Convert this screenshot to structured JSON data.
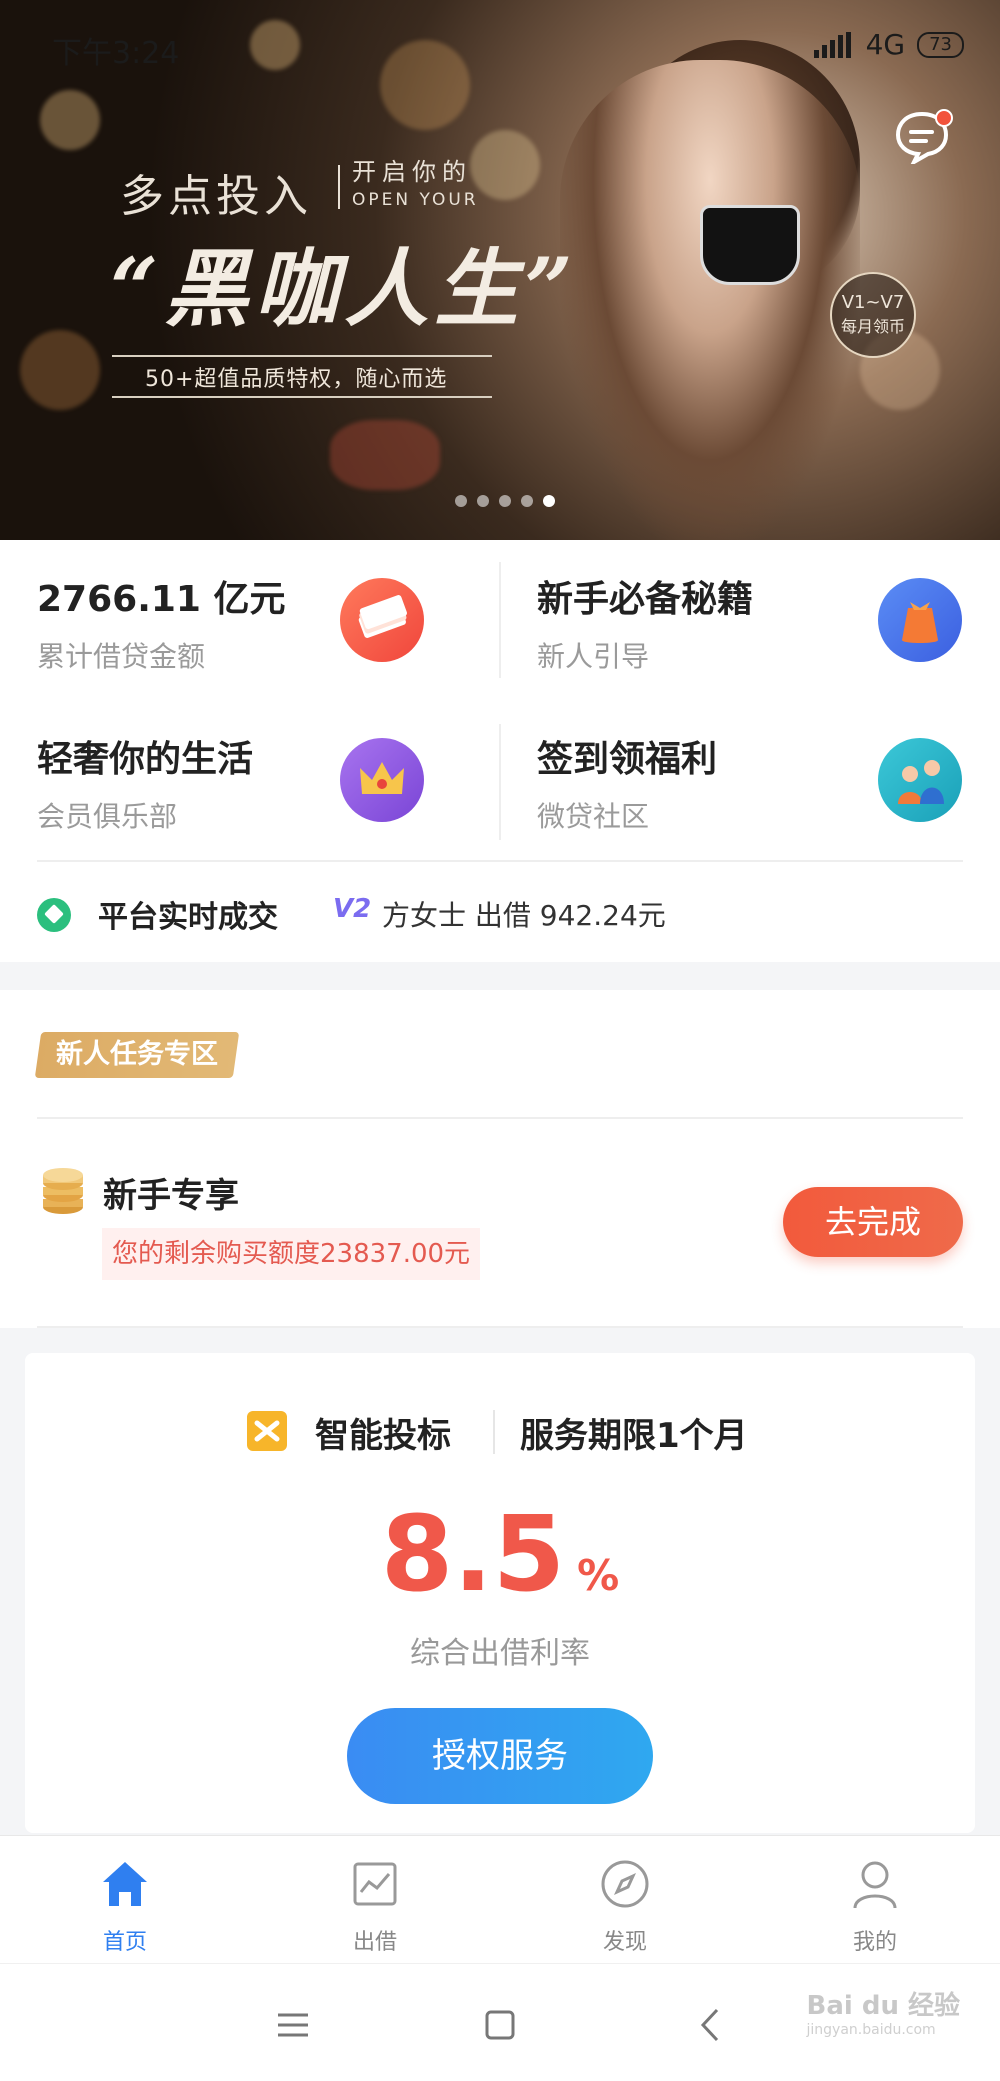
{
  "status_bar": {
    "time": "下午3:24",
    "network": "4G",
    "battery": "73"
  },
  "banner": {
    "line1": "多点投入",
    "line1_sub_top": "开启你的",
    "line1_sub_bottom": "OPEN YOUR",
    "headline": "“黑咖人生”",
    "tagline": "50+超值品质特权，随心而选",
    "badge_top": "V1~V7",
    "badge_bottom": "每月领币",
    "slide_count": 5,
    "active_slide": 5
  },
  "features": [
    {
      "title": "2766.11 亿元",
      "subtitle": "累计借贷金额",
      "icon": "money-stack-icon",
      "color": "#f25f4c"
    },
    {
      "title": "新手必备秘籍",
      "subtitle": "新人引导",
      "icon": "gift-bag-icon",
      "color": "#4a7cf2"
    },
    {
      "title": "轻奢你的生活",
      "subtitle": "会员俱乐部",
      "icon": "crown-icon",
      "color": "#8d5ae0"
    },
    {
      "title": "签到领福利",
      "subtitle": "微贷社区",
      "icon": "community-people-icon",
      "color": "#2bb4c9"
    }
  ],
  "ticker": {
    "label": "平台实时成交",
    "level": "V2",
    "text": "方女士 出借 942.24元"
  },
  "newbie": {
    "tag": "新人任务专区",
    "title": "新手专享",
    "quota": "您的剩余购买额度23837.00元",
    "button": "去完成"
  },
  "smart_bid": {
    "name": "智能投标",
    "period": "服务期限1个月",
    "rate": "8.5",
    "rate_unit": "%",
    "rate_label": "综合出借利率",
    "button": "授权服务"
  },
  "tabs": [
    {
      "label": "首页",
      "icon": "home-icon",
      "active": true
    },
    {
      "label": "出借",
      "icon": "chart-icon",
      "active": false
    },
    {
      "label": "发现",
      "icon": "compass-icon",
      "active": false
    },
    {
      "label": "我的",
      "icon": "user-icon",
      "active": false
    }
  ],
  "watermark": {
    "brand": "Bai du 经验",
    "url": "jingyan.baidu.com"
  },
  "colors": {
    "accent_blue": "#2f7ff0",
    "accent_red": "#f0584a",
    "gold": "#dcab64"
  }
}
